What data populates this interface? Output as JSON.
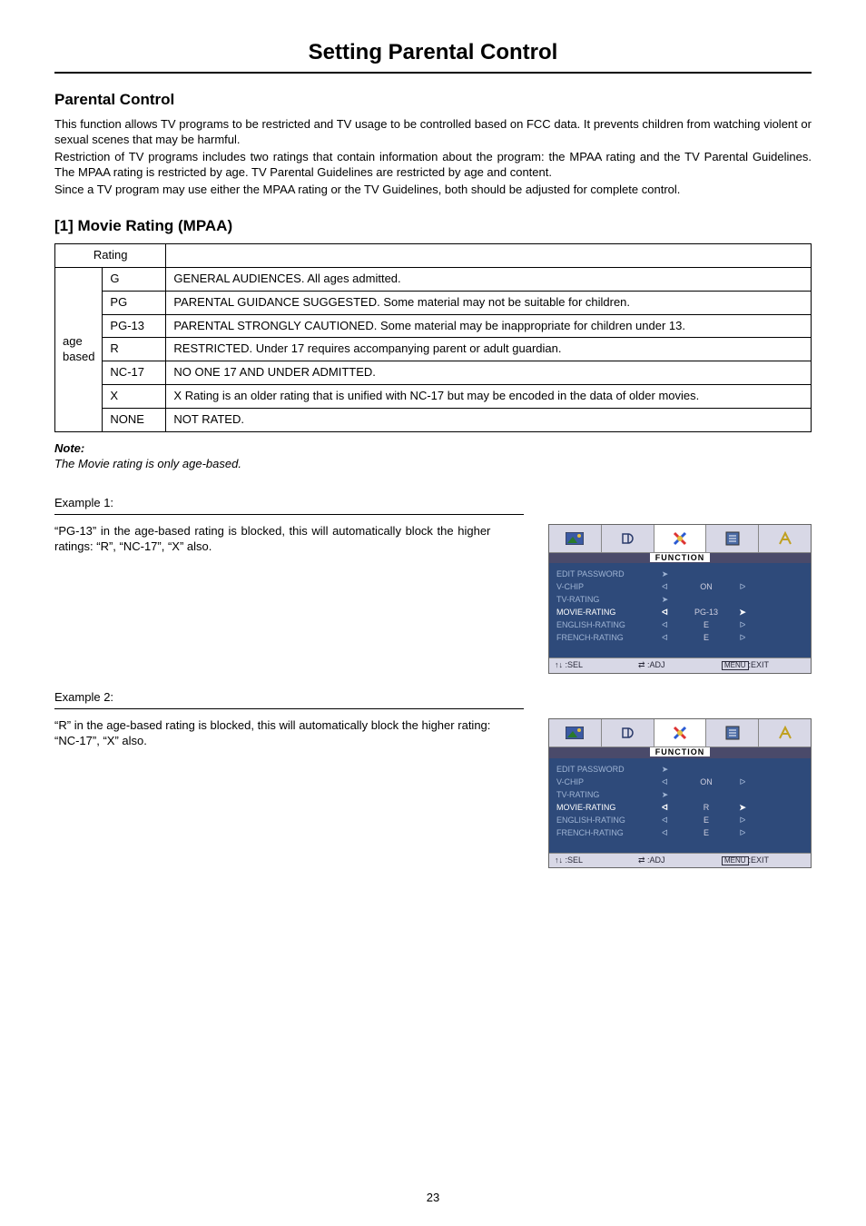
{
  "page": {
    "title": "Setting Parental Control",
    "number": "23"
  },
  "section1": {
    "heading": "Parental Control",
    "p1": "This function allows TV programs to be restricted and TV usage to be controlled based on FCC data. It prevents children from watching violent or sexual scenes that may be harmful.",
    "p2": "Restriction of TV programs includes two ratings that contain information about the program: the MPAA rating and the TV Parental Guidelines. The MPAA rating is restricted by age. TV Parental Guidelines are restricted by age and content.",
    "p3": "Since a TV program may use either the MPAA rating or the TV Guidelines, both should be adjusted for complete control."
  },
  "section2": {
    "heading": "[1] Movie Rating (MPAA)",
    "rating_header": "Rating",
    "age_label": "age based",
    "rows": [
      {
        "code": "G",
        "desc": "GENERAL AUDIENCES. All ages admitted."
      },
      {
        "code": "PG",
        "desc": "PARENTAL GUIDANCE SUGGESTED. Some material may not be suitable for children."
      },
      {
        "code": "PG-13",
        "desc": "PARENTAL STRONGLY CAUTIONED. Some material may be inappropriate for children under 13."
      },
      {
        "code": "R",
        "desc": "RESTRICTED. Under 17 requires accompanying parent or adult guardian."
      },
      {
        "code": "NC-17",
        "desc": "NO ONE 17 AND UNDER ADMITTED."
      },
      {
        "code": "X",
        "desc": "X Rating is an older rating that is unified with NC-17 but may be encoded in the data of older movies."
      },
      {
        "code": "NONE",
        "desc": "NOT RATED."
      }
    ],
    "note_h": "Note:",
    "note_b": "The Movie rating is only age-based."
  },
  "ex1": {
    "heading": "Example 1:",
    "body": "“PG-13” in the age-based rating is blocked, this will automatically block the higher ratings: “R”, “NC-17”, “X” also."
  },
  "ex2": {
    "heading": "Example 2:",
    "body": "“R” in the age-based rating is blocked, this will automatically block the higher rating: “NC-17”, “X” also."
  },
  "osd": {
    "function_label": "FUNCTION",
    "items": {
      "edit_password": "EDIT PASSWORD",
      "v_chip": "V-CHIP",
      "tv_rating": "TV-RATING",
      "movie_rating": "MOVIE-RATING",
      "english_rating": "ENGLISH-RATING",
      "french_rating": "FRENCH-RATING"
    },
    "on": "ON",
    "e": "E",
    "movie1": "PG-13",
    "movie2": "R",
    "foot_sel": "↑↓ :SEL",
    "foot_adj": "⇄ :ADJ",
    "foot_menu": "MENU",
    "foot_exit": ":EXIT"
  }
}
